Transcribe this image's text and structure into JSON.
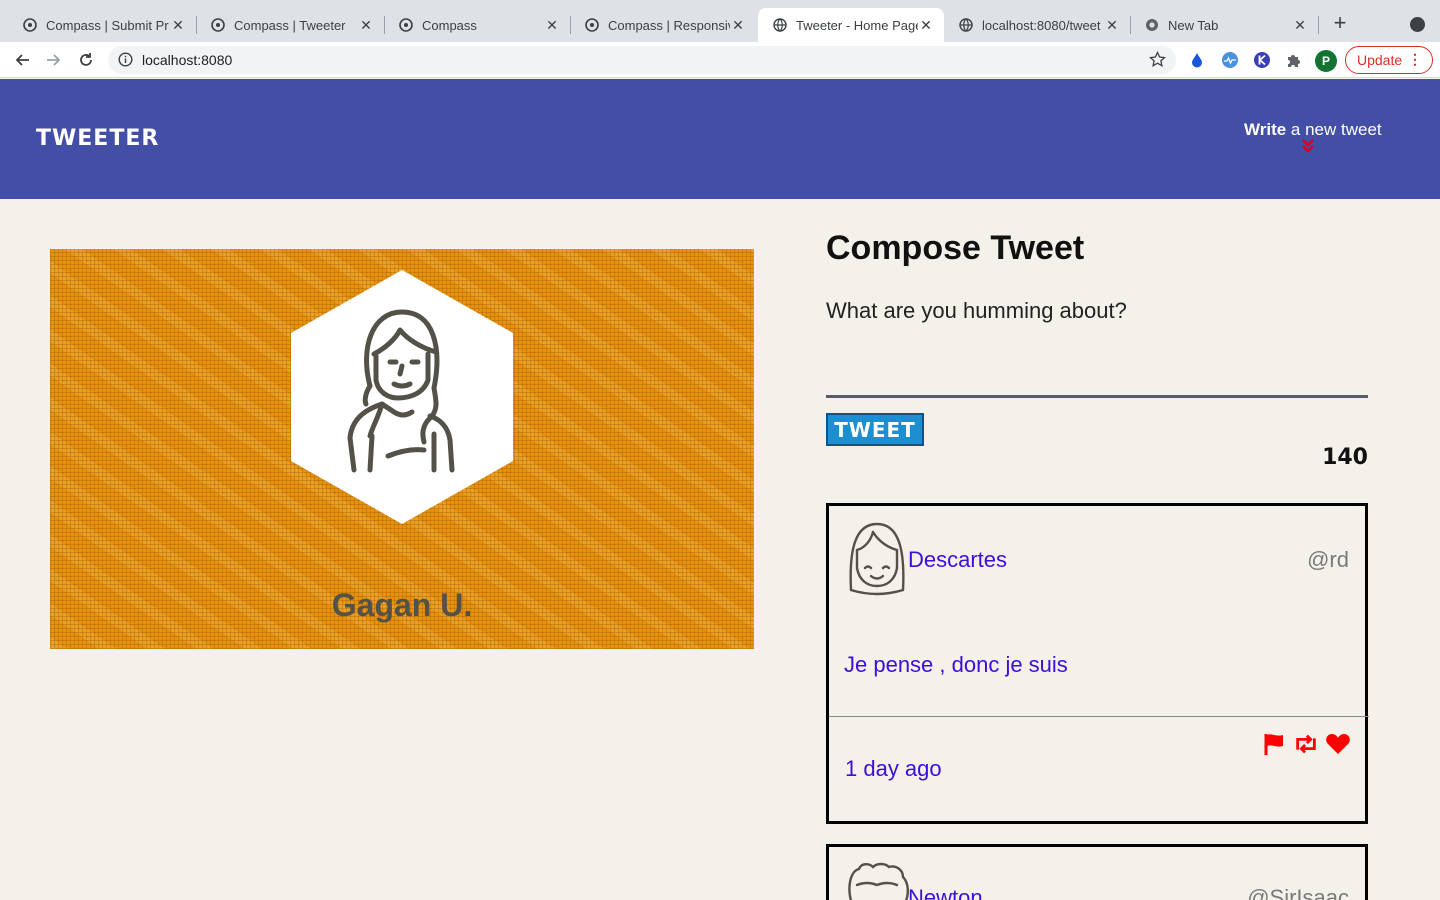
{
  "browser": {
    "tabs": [
      {
        "title": "Compass | Submit Pr",
        "active": false
      },
      {
        "title": "Compass | Tweeter",
        "active": false
      },
      {
        "title": "Compass",
        "active": false
      },
      {
        "title": "Compass | Responsiv",
        "active": false
      },
      {
        "title": "Tweeter - Home Page",
        "active": true
      },
      {
        "title": "localhost:8080/tweet",
        "active": false
      },
      {
        "title": "New Tab",
        "active": false
      }
    ],
    "url": "localhost:8080",
    "profile_initial": "P",
    "update_label": "Update",
    "icons": [
      "back-icon",
      "forward-icon",
      "reload-icon",
      "info-icon",
      "star-icon",
      "drop-extension-icon",
      "pulse-extension-icon",
      "k-extension-icon",
      "puzzle-extensions-icon"
    ]
  },
  "header": {
    "logo": "TWEETER",
    "write_bold": "Write",
    "write_rest": " a new tweet",
    "accent_color": "#434fa6",
    "arrow_color": "#e0001b"
  },
  "profile": {
    "name": "Gagan U."
  },
  "compose": {
    "title": "Compose Tweet",
    "placeholder": "What are you humming about?",
    "button_label": "TWEET",
    "counter": "140"
  },
  "tweets": [
    {
      "name": "Descartes",
      "handle": "@rd",
      "body": "Je pense , donc je suis",
      "time": "1 day ago"
    },
    {
      "name": "Newton",
      "handle": "@SirIsaac"
    }
  ]
}
